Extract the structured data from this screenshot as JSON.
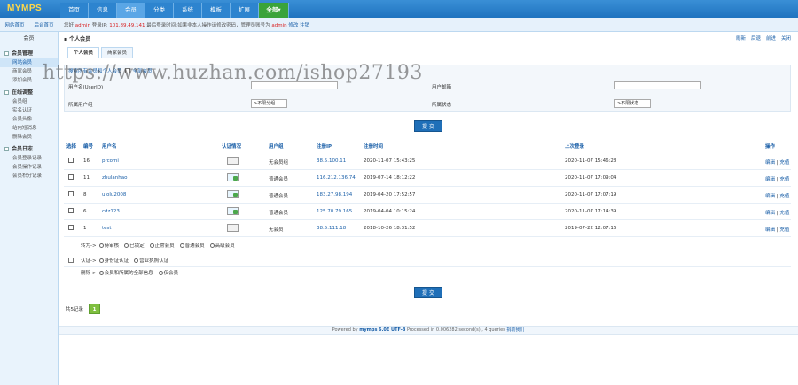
{
  "app": {
    "logo": "MYMPS"
  },
  "nav": {
    "tabs": [
      {
        "label": "首页"
      },
      {
        "label": "信息"
      },
      {
        "label": "会员"
      },
      {
        "label": "分类"
      },
      {
        "label": "系统"
      },
      {
        "label": "模板"
      },
      {
        "label": "扩展"
      },
      {
        "label": "全部"
      }
    ]
  },
  "quick": {
    "left": "网站首页",
    "right": "后台首页"
  },
  "welcome": {
    "prefix": "您好",
    "user": "admin",
    "ip_label": "登录IP:",
    "ip": "101.89.49.141",
    "note": "最后登录时间:如果非本人操作请修改密码，管理员账号为",
    "account": "admin",
    "modify": "修改",
    "logout": "注销"
  },
  "sidebar": {
    "head": "会员",
    "groups": [
      {
        "title": "会员管理",
        "items": [
          "网站会员",
          "商家会员",
          "添加会员"
        ]
      },
      {
        "title": "在线调整",
        "items": [
          "会员组",
          "实名认证",
          "会员头像",
          "站内短消息",
          "删除会员"
        ]
      },
      {
        "title": "会员日志",
        "items": [
          "会员登录记录",
          "会员操作记录",
          "会员积分记录"
        ]
      }
    ]
  },
  "breadcrumb": {
    "title": "个人会员",
    "links": [
      "刷新",
      "后退",
      "前进",
      "关闭"
    ]
  },
  "subtabs": [
    "个人会员",
    "商家会员"
  ],
  "filter": {
    "checkbox_label": "搜索所有会员和个人会员",
    "checkbox_label2": "全部会员",
    "username_label": "用户名(UserID)",
    "email_label": "用户邮箱",
    "group_label": "所属用户组",
    "group_value": ">不限分组",
    "status_label": "所属状态",
    "status_value": ">不限状态",
    "submit": "提 交"
  },
  "watermark": "https://www.huzhan.com/ishop27193",
  "table": {
    "headers": {
      "select": "选择",
      "id": "编号",
      "username": "用户名",
      "cert": "认证情况",
      "group": "用户组",
      "reg_ip": "注册IP",
      "reg_time": "注册时间",
      "last_login": "上次登录",
      "ops": "操作"
    },
    "rows": [
      {
        "id": "16",
        "username": "prcomi",
        "group": "无会员组",
        "ip": "38.5.100.11",
        "reg_time": "2020-11-07 15:43:25",
        "last": "2020-11-07 15:46:28",
        "op1": "编辑",
        "op2": "充值"
      },
      {
        "id": "11",
        "username": "zhulanhao",
        "group": "普通会员",
        "ip": "116.212.136.74",
        "reg_time": "2019-07-14 18:12:22",
        "last": "2020-11-07 17:09:04",
        "op1": "编辑",
        "op2": "充值"
      },
      {
        "id": "8",
        "username": "ulolu2008",
        "group": "普通会员",
        "ip": "183.27.98.194",
        "reg_time": "2019-04-20 17:52:57",
        "last": "2020-11-07 17:07:19",
        "op1": "编辑",
        "op2": "充值"
      },
      {
        "id": "6",
        "username": "cdz123",
        "group": "普通会员",
        "ip": "125.70.79.165",
        "reg_time": "2019-04-04 10:15:24",
        "last": "2020-11-07 17:14:39",
        "op1": "编辑",
        "op2": "充值"
      },
      {
        "id": "1",
        "username": "test",
        "group": "无会员",
        "ip": "38.5.111.18",
        "reg_time": "2018-10-26 18:31:52",
        "last": "2019-07-22 12:07:16",
        "op1": "编辑",
        "op2": "充值"
      }
    ]
  },
  "batch": {
    "set_label": "转为->",
    "set_options": [
      "待审核",
      "已锁定",
      "正常会员",
      "普通会员",
      "高级会员"
    ],
    "cert_label": "认证->",
    "cert_options": [
      "身份证认证",
      "营业执照认证"
    ],
    "delete_label": "删除->",
    "delete_options": [
      "会员和所属的全部信息",
      "仅会员"
    ],
    "submit": "提 交"
  },
  "pager": {
    "total": "共5记录",
    "current": "1"
  },
  "footer": {
    "text_before": "Powered by",
    "brand": "mymps",
    "version": "6.0E UTF-8",
    "text_after": "Processed in 0.006282 second(s) , 4 queries",
    "link": "捐助我们"
  }
}
